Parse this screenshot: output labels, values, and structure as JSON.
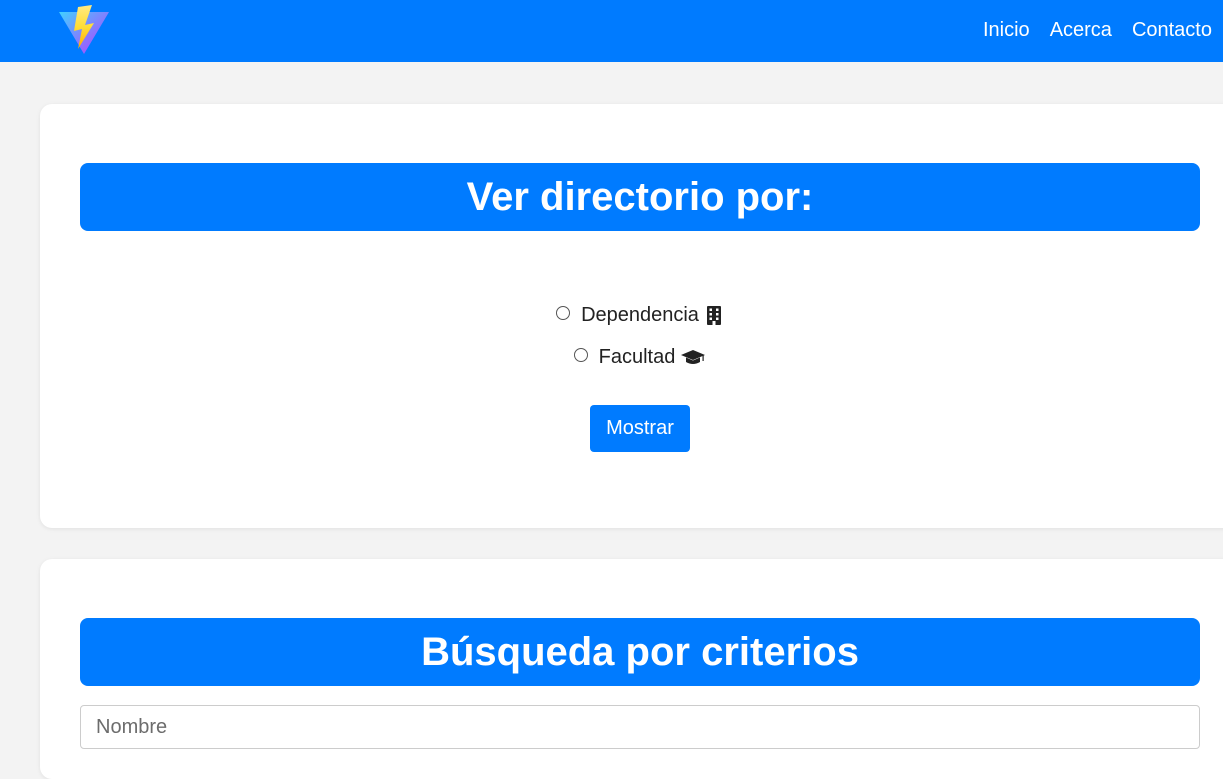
{
  "brand": {
    "logo_icon": "vite-lightning-logo",
    "colors": {
      "primary": "#007bff",
      "background": "#f3f3f3",
      "card": "#ffffff"
    }
  },
  "nav": {
    "items": [
      {
        "label": "Inicio"
      },
      {
        "label": "Acerca"
      },
      {
        "label": "Contacto"
      }
    ]
  },
  "directory_card": {
    "title": "Ver directorio por:",
    "options": [
      {
        "label": "Dependencia",
        "icon": "office-building-icon",
        "checked": false
      },
      {
        "label": "Facultad",
        "icon": "graduation-cap-icon",
        "checked": false
      }
    ],
    "button_label": "Mostrar"
  },
  "search_card": {
    "title": "Búsqueda por criterios",
    "name_placeholder": "Nombre",
    "name_value": ""
  }
}
